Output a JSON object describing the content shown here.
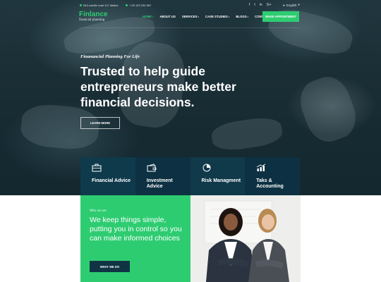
{
  "topbar": {
    "address": "543 colville road 127 district",
    "phone": "+ 00 123 234 567",
    "socials": [
      "f",
      "t",
      "in",
      "G+"
    ],
    "language": "English"
  },
  "brand": {
    "name": "Finlance",
    "tagline": "financial planning"
  },
  "nav": {
    "items": [
      {
        "label": "HOME",
        "has_menu": true
      },
      {
        "label": "ABOUT US",
        "has_menu": false
      },
      {
        "label": "SERVICES",
        "has_menu": true
      },
      {
        "label": "CASE STUDIES",
        "has_menu": true
      },
      {
        "label": "BLOGS",
        "has_menu": true
      },
      {
        "label": "CONTACT",
        "has_menu": false
      }
    ],
    "cta": "MAKE APPOINTMENT"
  },
  "hero": {
    "subtitle": "Finanancial Planning For Life",
    "title": "Trusted to help guide entrepreneurs make better financial decisions.",
    "button": "LEARN MORE"
  },
  "services": [
    {
      "label": "Financial Advice",
      "icon": "briefcase-icon"
    },
    {
      "label": "Investment Advice",
      "icon": "wallet-icon"
    },
    {
      "label": "Risk Managment",
      "icon": "pie-chart-icon"
    },
    {
      "label": "Taks & Accounting",
      "icon": "bar-chart-icon"
    }
  ],
  "about": {
    "label": "Who we are",
    "copy": "We keep things simple, putting you in control so you can make informed choices",
    "button": "WHAT WE DO"
  },
  "colors": {
    "accent": "#2ecc71",
    "navy": "#0d3142",
    "hero": "#1a2e35"
  }
}
